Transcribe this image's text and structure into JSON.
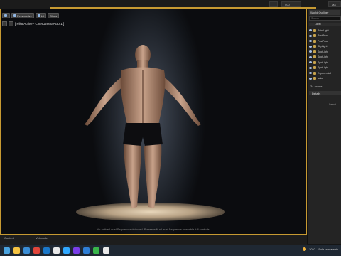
{
  "window": {
    "tab_b": "000",
    "tab_c": "Ma"
  },
  "viewport": {
    "toolbar": [
      {
        "label": ""
      },
      {
        "label": "Perspective"
      },
      {
        "label": "Lit"
      },
      {
        "label": "Show"
      }
    ],
    "pilot_label": "[ Pilot Active - CineCameraActor1 ]",
    "message": "No active Level Sequencer detected. Please edit a Level Sequence to enable full controls."
  },
  "outliner": {
    "tab": "World Outliner",
    "search_placeholder": "Search",
    "column_label": "Label",
    "items": [
      {
        "label": "PointLight"
      },
      {
        "label": "PostProc"
      },
      {
        "label": "PostProc"
      },
      {
        "label": "SkyLight"
      },
      {
        "label": "SpotLight"
      },
      {
        "label": "SpotLight"
      },
      {
        "label": "SpotLight"
      },
      {
        "label": "SpotLight"
      },
      {
        "label": "ExponentialH"
      },
      {
        "label": "actor"
      }
    ],
    "actor_count": "24 actors"
  },
  "details": {
    "tab": "Details",
    "hint": "Select"
  },
  "bottom_tabs": [
    "Content",
    "Vid model"
  ],
  "taskbar": {
    "icon_colors": [
      "#4aa3df",
      "#f5c342",
      "#3b8ed6",
      "#e2463b",
      "#1b78c9",
      "#e8e8e8",
      "#31a8ff",
      "#7a3ee8",
      "#2f7fd6",
      "#39b54a",
      "#e8e8e8"
    ],
    "temperature": "20°C",
    "weather": "Sole prevalente"
  }
}
